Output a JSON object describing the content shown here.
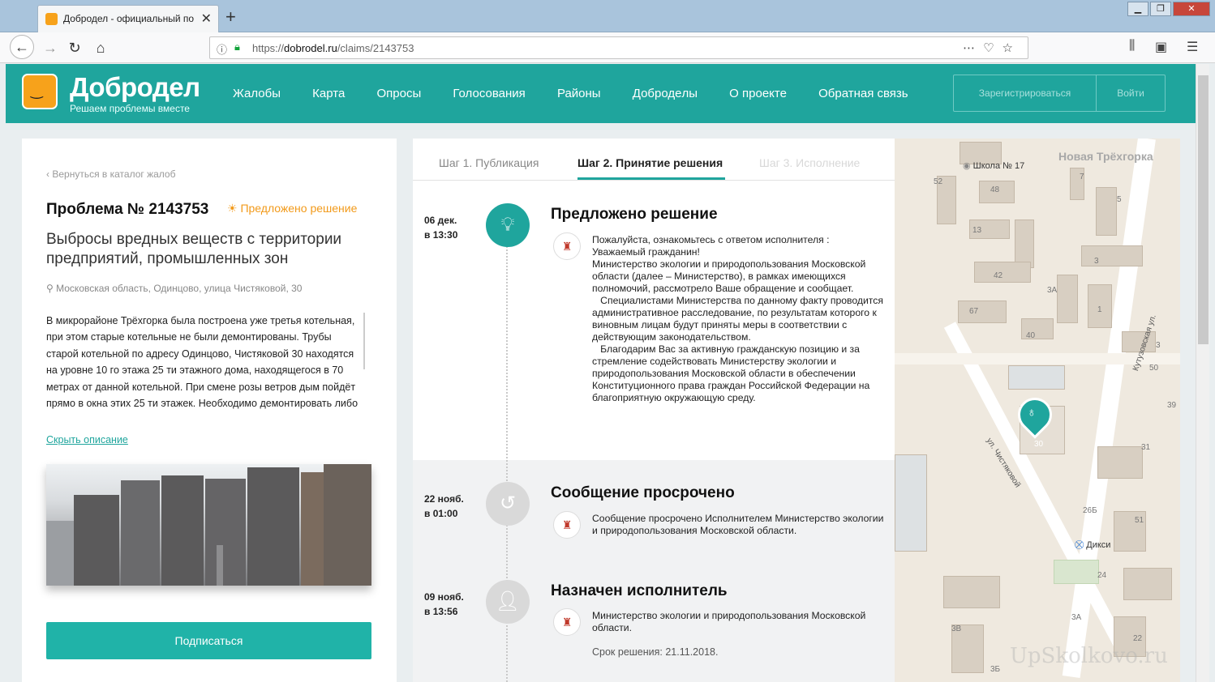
{
  "browser": {
    "tab_title": "Добродел - официальный по",
    "url_prefix": "https://",
    "url_domain": "dobrodel.ru",
    "url_path": "/claims/2143753"
  },
  "site": {
    "logo_name": "Добродел",
    "logo_tagline": "Решаем проблемы вместе",
    "nav": [
      "Жалобы",
      "Карта",
      "Опросы",
      "Голосования",
      "Районы",
      "Добродeлы",
      "О проекте",
      "Обратная связь"
    ],
    "register_label": "Зарегистрироваться",
    "login_label": "Войти",
    "brand_color": "#1fa59d"
  },
  "problem": {
    "back_link": "Вернуться в каталог жалоб",
    "number": "Проблема № 2143753",
    "status": "Предложено решение",
    "title": "Выбросы вредных веществ с территории предприятий, промышленных зон",
    "address": "Московская область, Одинцово, улица Чистяковой, 30",
    "description": "В микрорайоне Трёхгорка была построена уже третья котельная, при этом старые котельные не были демонтированы. Трубы старой котельной по адресу Одинцово, Чистяковой 30 находятся на уровне 10 го этажа 25 ти этажного дома, находящегося в 70 метрах от данной котельной. При смене розы ветров дым пойдёт прямо в окна этих 25 ти этажек. Необходимо демонтировать либо",
    "hide_link": "Скрыть описание",
    "subscribe_label": "Подписаться"
  },
  "steps": [
    "Шаг 1. Публикация",
    "Шаг 2. Принятие решения",
    "Шаг 3. Исполнение"
  ],
  "events": [
    {
      "date": "06 дек.",
      "time": "в 13:30",
      "title": "Предложено решение",
      "text": "Пожалуйста, ознакомьтесь с ответом исполнителя :\nУважаемый гражданин!\nМинистерство экологии и природопользования Московской области (далее – Министерство), в рамках имеющихся полномочий, рассмотрело Ваше обращение и сообщает.\n   Специалистами Министерства по данному факту проводится административное расследование, по результатам которого к виновным лицам будут приняты меры в соответствии с действующим законодательством.\n   Благодарим Вас за активную гражданскую позицию и за стремление содействовать Министерству экологии и природопользования Московской области в обеспечении Конституционного права граждан Российской Федерации на благоприятную окружающую среду."
    },
    {
      "date": "22 нояб.",
      "time": "в 01:00",
      "title": "Сообщение просрочено",
      "text": "Сообщение просрочено Исполнителем Министерство экологии и природопользования Московской области."
    },
    {
      "date": "09 нояб.",
      "time": "в 13:56",
      "title": "Назначен исполнитель",
      "text": "Министерство экологии и природопользования Московской области.",
      "deadline": "Срок решения: 21.11.2018."
    }
  ],
  "map": {
    "area": "Новая Трёхгорка",
    "school": "Школа № 17",
    "street1": "Кутузовская ул.",
    "street2": "ул. Чистяковой",
    "shop": "Дикси",
    "house_numbers": [
      "52",
      "48",
      "7",
      "5",
      "13",
      "42",
      "3",
      "3А",
      "67",
      "1",
      "40",
      "3",
      "50",
      "39",
      "30",
      "31",
      "26Б",
      "51",
      "24",
      "3В",
      "3А",
      "22",
      "3Б"
    ]
  },
  "watermark": "UpSkolkovo.ru"
}
